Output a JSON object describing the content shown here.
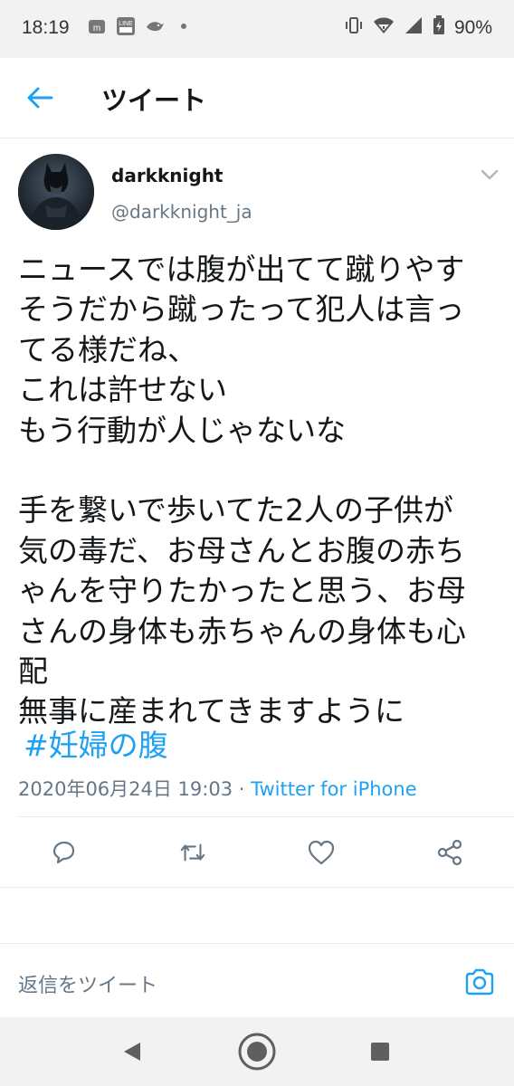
{
  "status_bar": {
    "time": "18:19",
    "battery": "90%",
    "icons_left": [
      "mercari-icon",
      "line-manga-icon",
      "bird-app-icon",
      "dot-icon"
    ],
    "icons_right": [
      "vibrate-icon",
      "wifi-icon",
      "signal-icon",
      "battery-icon"
    ]
  },
  "header": {
    "title": "ツイート",
    "back_icon": "arrow-left-icon",
    "accent": "#1da1f2"
  },
  "tweet": {
    "author_name": "darkknight",
    "author_handle": "@darkknight_ja",
    "body": "ニュースでは腹が出てて蹴りやす\nそうだから蹴ったって犯人は言っ\nてる様だね、\nこれは許せない\nもう行動が人じゃないな\n\n手を繋いで歩いてた2人の子供が\n気の毒だ、お母さんとお腹の赤ち\nゃんを守りたかったと思う、お母\nさんの身体も赤ちゃんの身体も心\n配\n無事に産まれてきますように",
    "hashtag": "#妊婦の腹",
    "timestamp": "2020年06月24日 19:03",
    "separator": " · ",
    "source": "Twitter for iPhone"
  },
  "actions": {
    "icons": [
      "reply-icon",
      "retweet-icon",
      "like-icon",
      "share-icon"
    ]
  },
  "reply": {
    "placeholder": "返信をツイート",
    "camera_icon": "camera-icon"
  },
  "nav": {
    "icons": [
      "back-triangle-icon",
      "home-circle-icon",
      "recents-square-icon"
    ]
  }
}
